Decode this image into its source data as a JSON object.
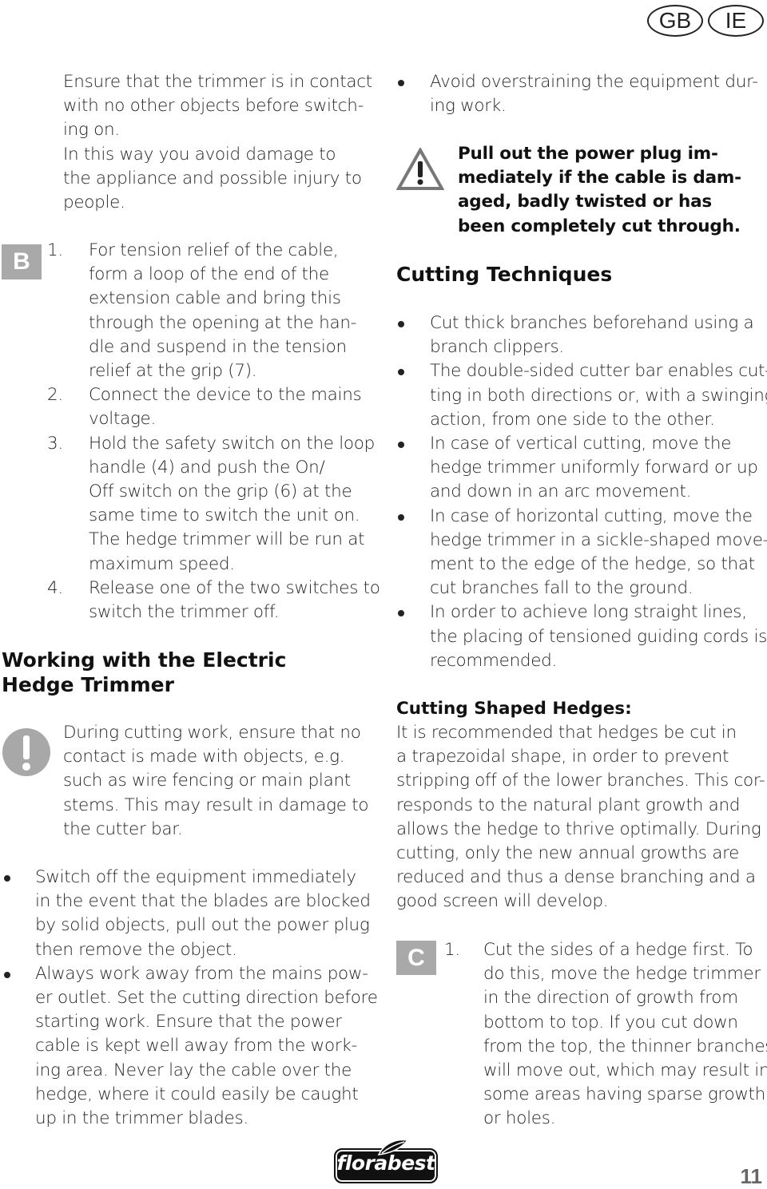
{
  "header": {
    "country_badges": [
      "GB",
      "IE"
    ]
  },
  "figure_labels": {
    "b": "B",
    "c": "C"
  },
  "left_column": {
    "intro_lines": [
      "Ensure that the trimmer is in contact",
      "with no other objects before switch-",
      "ing on.",
      "In this way you avoid damage to",
      "the appliance and possible injury to",
      "people."
    ],
    "steps": [
      {
        "number": "1.",
        "lines": [
          "For tension relief of the cable,",
          "form a loop of the end of the",
          "extension cable and bring this",
          "through the opening at the han-",
          "dle and suspend in the tension",
          "relief at the grip (7)."
        ]
      },
      {
        "number": "2.",
        "lines": [
          "Connect the device to the mains",
          "voltage."
        ]
      },
      {
        "number": "3.",
        "lines": [
          "Hold the safety switch on the loop",
          "handle (4) and push the On/",
          "Off switch on the grip (6) at the",
          "same time to switch the unit on.",
          "The hedge trimmer will be run at",
          "maximum speed."
        ]
      },
      {
        "number": "4.",
        "lines": [
          "Release one of the two switches to",
          "switch the trimmer off."
        ]
      }
    ],
    "section_heading_lines": [
      "Working with the Electric",
      "Hedge Trimmer"
    ],
    "notice_lines": [
      "During cutting work, ensure that no",
      "contact is made with objects, e.g.",
      "such as wire fencing or main plant",
      "stems. This may result in damage to",
      "the cutter bar."
    ],
    "bullets": [
      {
        "lines": [
          "Switch off the equipment immediately",
          "in the event that the blades are blocked",
          "by solid objects, pull out the power plug",
          "then remove the object."
        ]
      },
      {
        "lines": [
          "Always work away from the mains pow-",
          "er outlet. Set the cutting direction before",
          "starting work. Ensure that the power",
          "cable is kept well away from the work-",
          "ing area. Never lay the cable over the",
          "hedge, where it could easily be caught",
          "up in the trimmer blades."
        ]
      }
    ]
  },
  "right_column": {
    "top_bullet_lines": [
      "Avoid overstraining the equipment dur-",
      "ing work."
    ],
    "warning_lines": [
      "Pull out the power plug im-",
      "mediately if the cable is dam-",
      "aged, badly twisted or has",
      "been completely cut through."
    ],
    "cutting_techniques": {
      "heading": "Cutting Techniques",
      "bullets": [
        {
          "lines": [
            "Cut thick branches beforehand using a",
            "branch clippers."
          ]
        },
        {
          "lines": [
            "The double-sided cutter bar enables cut-",
            "ting in both directions or, with a swinging",
            "action, from one side to the other."
          ]
        },
        {
          "lines": [
            "In case of vertical cutting, move the",
            "hedge trimmer uniformly forward or up",
            "and down in an arc movement."
          ]
        },
        {
          "lines": [
            "In case of horizontal cutting, move the",
            "hedge trimmer in a sickle-shaped move-",
            "ment to the edge of the hedge, so that",
            "cut branches fall to the ground."
          ]
        },
        {
          "lines": [
            "In order to achieve long straight lines,",
            "the placing of tensioned guiding cords is",
            "recommended."
          ]
        }
      ]
    },
    "shaped_hedges": {
      "heading": "Cutting Shaped Hedges:",
      "lines": [
        "It is recommended that hedges be cut in",
        "a trapezoidal shape, in order to prevent",
        "stripping off of the lower branches. This cor-",
        "responds to the natural plant growth and",
        "allows the hedge to thrive optimally. During",
        "cutting, only the new annual growths are",
        "reduced and thus a dense branching and a",
        "good screen will develop."
      ]
    },
    "step_c": {
      "number": "1.",
      "lines": [
        "Cut the sides of a hedge first. To",
        "do this, move the hedge trimmer",
        "in the direction of growth from",
        "bottom to top. If you cut down",
        "from the top, the thinner branches",
        "will move out, which may result in",
        "some areas having sparse growth",
        "or holes."
      ]
    }
  },
  "footer": {
    "brand": "florabest",
    "page_number": "11"
  }
}
